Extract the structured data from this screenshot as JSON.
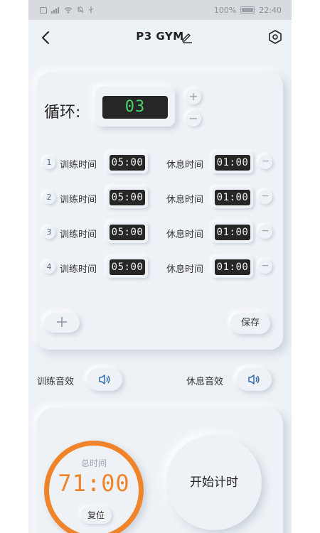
{
  "status_bar": {
    "left_icons": [
      "sim-icon",
      "signal-icon",
      "wifi-icon",
      "mute-icon",
      "usb-icon"
    ],
    "battery": "100%",
    "time": "22:40"
  },
  "header": {
    "title": "P3 GYM",
    "back_icon": "back-arrow-icon",
    "edit_icon": "pencil-icon",
    "settings_icon": "hexagon-settings-icon"
  },
  "cycle": {
    "label": "循环:",
    "value": "03",
    "plus": "+",
    "minus": "−"
  },
  "intervals": [
    {
      "num": "1",
      "train_label": "训练时间",
      "train_time": "05:00",
      "rest_label": "休息时间",
      "rest_time": "01:00",
      "remove": "−"
    },
    {
      "num": "2",
      "train_label": "训练时间",
      "train_time": "05:00",
      "rest_label": "休息时间",
      "rest_time": "01:00",
      "remove": "−"
    },
    {
      "num": "3",
      "train_label": "训练时间",
      "train_time": "05:00",
      "rest_label": "休息时间",
      "rest_time": "01:00",
      "remove": "−"
    },
    {
      "num": "4",
      "train_label": "训练时间",
      "train_time": "05:00",
      "rest_label": "休息时间",
      "rest_time": "01:00",
      "remove": "−"
    }
  ],
  "actions": {
    "add": "+",
    "save": "保存"
  },
  "sounds": {
    "train_label": "训练音效",
    "rest_label": "休息音效",
    "icon": "speaker-icon"
  },
  "timer": {
    "total_label": "总时间",
    "total_time": "71:00",
    "reset": "复位",
    "start": "开始计时"
  },
  "colors": {
    "accent_orange": "#f0842a",
    "lcd_green": "#4bd26a",
    "icon_blue": "#2f6db0",
    "background": "#ecf1f5"
  }
}
